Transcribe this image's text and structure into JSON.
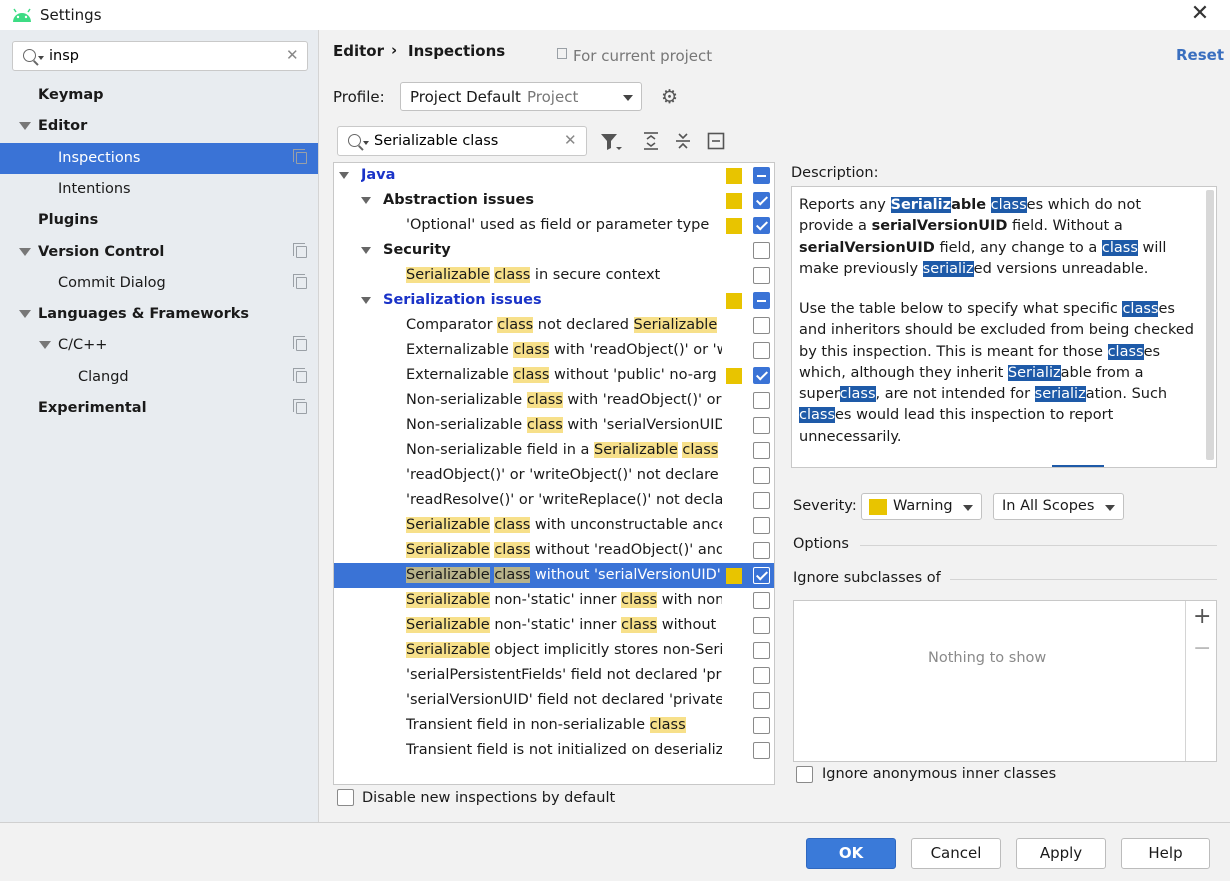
{
  "window": {
    "title": "Settings"
  },
  "sidebar": {
    "search_value": "insp",
    "items": [
      {
        "label": "Keymap",
        "indent": 0,
        "bold": true,
        "arrow": false,
        "copy": false,
        "selected": false
      },
      {
        "label": "Editor",
        "indent": 0,
        "bold": true,
        "arrow": true,
        "copy": false,
        "selected": false
      },
      {
        "label": "Inspections",
        "indent": 1,
        "bold": false,
        "arrow": false,
        "copy": true,
        "selected": true
      },
      {
        "label": "Intentions",
        "indent": 1,
        "bold": false,
        "arrow": false,
        "copy": false,
        "selected": false
      },
      {
        "label": "Plugins",
        "indent": 0,
        "bold": true,
        "arrow": false,
        "copy": false,
        "selected": false
      },
      {
        "label": "Version Control",
        "indent": 0,
        "bold": true,
        "arrow": true,
        "copy": true,
        "selected": false
      },
      {
        "label": "Commit Dialog",
        "indent": 1,
        "bold": false,
        "arrow": false,
        "copy": true,
        "selected": false
      },
      {
        "label": "Languages & Frameworks",
        "indent": 0,
        "bold": true,
        "arrow": true,
        "copy": false,
        "selected": false
      },
      {
        "label": "C/C++",
        "indent": 1,
        "bold": false,
        "arrow": true,
        "copy": true,
        "selected": false
      },
      {
        "label": "Clangd",
        "indent": 2,
        "bold": false,
        "arrow": false,
        "copy": true,
        "selected": false
      },
      {
        "label": "Experimental",
        "indent": 0,
        "bold": true,
        "arrow": false,
        "copy": true,
        "selected": false
      }
    ]
  },
  "header": {
    "breadcrumb_root": "Editor",
    "breadcrumb_sep": "›",
    "breadcrumb_current": "Inspections",
    "scope_note": "For current project",
    "reset_label": "Reset"
  },
  "profile": {
    "label": "Profile:",
    "value": "Project Default",
    "suffix": "Project"
  },
  "filter": {
    "value": "Serializable class"
  },
  "tree": [
    {
      "level": 0,
      "kind": "lang",
      "segments": [
        [
          "Java",
          false
        ]
      ],
      "arrow": true,
      "sev": true,
      "check": "mixed"
    },
    {
      "level": 1,
      "kind": "group",
      "segments": [
        [
          "Abstraction issues",
          false
        ]
      ],
      "arrow": true,
      "sev": true,
      "check": "on"
    },
    {
      "level": 2,
      "kind": "item",
      "segments": [
        [
          "'Optional' used as field or parameter type",
          false
        ]
      ],
      "arrow": false,
      "sev": true,
      "check": "on"
    },
    {
      "level": 1,
      "kind": "group",
      "segments": [
        [
          "Security",
          false
        ]
      ],
      "arrow": true,
      "sev": false,
      "check": "off"
    },
    {
      "level": 2,
      "kind": "item",
      "segments": [
        [
          "Serializable",
          true
        ],
        [
          " ",
          false
        ],
        [
          "class",
          true
        ],
        [
          " in secure context",
          false
        ]
      ],
      "arrow": false,
      "sev": false,
      "check": "off"
    },
    {
      "level": 1,
      "kind": "lang",
      "segments": [
        [
          "Serialization issues",
          false
        ]
      ],
      "arrow": true,
      "sev": true,
      "check": "mixed"
    },
    {
      "level": 2,
      "kind": "item",
      "segments": [
        [
          "Comparator ",
          false
        ],
        [
          "class",
          true
        ],
        [
          " not declared ",
          false
        ],
        [
          "Serializable",
          true
        ]
      ],
      "arrow": false,
      "sev": false,
      "check": "off"
    },
    {
      "level": 2,
      "kind": "item",
      "segments": [
        [
          "Externalizable ",
          false
        ],
        [
          "class",
          true
        ],
        [
          " with 'readObject()' or 'w",
          false
        ]
      ],
      "arrow": false,
      "sev": false,
      "check": "off"
    },
    {
      "level": 2,
      "kind": "item",
      "segments": [
        [
          "Externalizable ",
          false
        ],
        [
          "class",
          true
        ],
        [
          " without 'public' no-arg c",
          false
        ]
      ],
      "arrow": false,
      "sev": true,
      "check": "on"
    },
    {
      "level": 2,
      "kind": "item",
      "segments": [
        [
          "Non-serializable ",
          false
        ],
        [
          "class",
          true
        ],
        [
          " with 'readObject()' or",
          false
        ]
      ],
      "arrow": false,
      "sev": false,
      "check": "off"
    },
    {
      "level": 2,
      "kind": "item",
      "segments": [
        [
          "Non-serializable ",
          false
        ],
        [
          "class",
          true
        ],
        [
          " with 'serialVersionUID",
          false
        ]
      ],
      "arrow": false,
      "sev": false,
      "check": "off"
    },
    {
      "level": 2,
      "kind": "item",
      "segments": [
        [
          "Non-serializable field in a ",
          false
        ],
        [
          "Serializable",
          true
        ],
        [
          " ",
          false
        ],
        [
          "class",
          true
        ]
      ],
      "arrow": false,
      "sev": false,
      "check": "off"
    },
    {
      "level": 2,
      "kind": "item",
      "segments": [
        [
          "'readObject()' or 'writeObject()' not declare",
          false
        ]
      ],
      "arrow": false,
      "sev": false,
      "check": "off"
    },
    {
      "level": 2,
      "kind": "item",
      "segments": [
        [
          "'readResolve()' or 'writeReplace()' not decla",
          false
        ]
      ],
      "arrow": false,
      "sev": false,
      "check": "off"
    },
    {
      "level": 2,
      "kind": "item",
      "segments": [
        [
          "Serializable",
          true
        ],
        [
          " ",
          false
        ],
        [
          "class",
          true
        ],
        [
          " with unconstructable ance",
          false
        ]
      ],
      "arrow": false,
      "sev": false,
      "check": "off"
    },
    {
      "level": 2,
      "kind": "item",
      "segments": [
        [
          "Serializable",
          true
        ],
        [
          " ",
          false
        ],
        [
          "class",
          true
        ],
        [
          " without 'readObject()' and",
          false
        ]
      ],
      "arrow": false,
      "sev": false,
      "check": "off"
    },
    {
      "level": 2,
      "kind": "item",
      "selected": true,
      "segments": [
        [
          "Serializable",
          true
        ],
        [
          " ",
          false
        ],
        [
          "class",
          true
        ],
        [
          " without 'serialVersionUID'",
          false
        ]
      ],
      "arrow": false,
      "sev": true,
      "check": "on"
    },
    {
      "level": 2,
      "kind": "item",
      "segments": [
        [
          "Serializable",
          true
        ],
        [
          " non-'static' inner ",
          false
        ],
        [
          "class",
          true
        ],
        [
          " with non-",
          false
        ]
      ],
      "arrow": false,
      "sev": false,
      "check": "off"
    },
    {
      "level": 2,
      "kind": "item",
      "segments": [
        [
          "Serializable",
          true
        ],
        [
          " non-'static' inner ",
          false
        ],
        [
          "class",
          true
        ],
        [
          " without 's",
          false
        ]
      ],
      "arrow": false,
      "sev": false,
      "check": "off"
    },
    {
      "level": 2,
      "kind": "item",
      "segments": [
        [
          "Serializable",
          true
        ],
        [
          " object implicitly stores non-Seri",
          false
        ]
      ],
      "arrow": false,
      "sev": false,
      "check": "off"
    },
    {
      "level": 2,
      "kind": "item",
      "segments": [
        [
          "'serialPersistentFields' field not declared 'pr",
          false
        ]
      ],
      "arrow": false,
      "sev": false,
      "check": "off"
    },
    {
      "level": 2,
      "kind": "item",
      "segments": [
        [
          "'serialVersionUID' field not declared 'private",
          false
        ]
      ],
      "arrow": false,
      "sev": false,
      "check": "off"
    },
    {
      "level": 2,
      "kind": "item",
      "segments": [
        [
          "Transient field in non-serializable ",
          false
        ],
        [
          "class",
          true
        ]
      ],
      "arrow": false,
      "sev": false,
      "check": "off"
    },
    {
      "level": 2,
      "kind": "item",
      "segments": [
        [
          "Transient field is not initialized on deserializ",
          false
        ]
      ],
      "arrow": false,
      "sev": false,
      "check": "off"
    }
  ],
  "disable_new": {
    "label": "Disable new inspections by default",
    "checked": false
  },
  "description": {
    "label": "Description:",
    "p1": [
      [
        "Reports any ",
        "n"
      ],
      [
        "Serializ",
        "sb"
      ],
      [
        "able",
        "b"
      ],
      [
        " ",
        "n"
      ],
      [
        "class",
        "s"
      ],
      [
        "es which do not provide a ",
        "n"
      ],
      [
        "serialVersionUID",
        "b"
      ],
      [
        " field. Without a ",
        "n"
      ],
      [
        "serialVersionUID",
        "b"
      ],
      [
        " field, any change to a ",
        "n"
      ],
      [
        "class",
        "s"
      ],
      [
        " will make previously ",
        "n"
      ],
      [
        "serializ",
        "s"
      ],
      [
        "ed versions unreadable.",
        "n"
      ]
    ],
    "p2": [
      [
        "Use the table below to specify what specific ",
        "n"
      ],
      [
        "class",
        "s"
      ],
      [
        "es and inheritors should be excluded from being checked by this inspection. This is meant for those ",
        "n"
      ],
      [
        "class",
        "s"
      ],
      [
        "es which, although they inherit ",
        "n"
      ],
      [
        "Serializ",
        "s"
      ],
      [
        "able from a super",
        "n"
      ],
      [
        "class",
        "s"
      ],
      [
        ", are not intended for ",
        "n"
      ],
      [
        "serializ",
        "s"
      ],
      [
        "ation. Such ",
        "n"
      ],
      [
        "class",
        "s"
      ],
      [
        "es would lead this inspection to report unnecessarily.",
        "n"
      ]
    ]
  },
  "severity": {
    "label": "Severity:",
    "value": "Warning",
    "color": "#e8c400",
    "scope": "In All Scopes"
  },
  "options": {
    "label": "Options",
    "ignore_label": "Ignore subclasses of",
    "empty_text": "Nothing to show",
    "anon_label": "Ignore anonymous inner classes",
    "anon_checked": false
  },
  "buttons": {
    "ok": "OK",
    "cancel": "Cancel",
    "apply": "Apply",
    "help": "Help"
  }
}
